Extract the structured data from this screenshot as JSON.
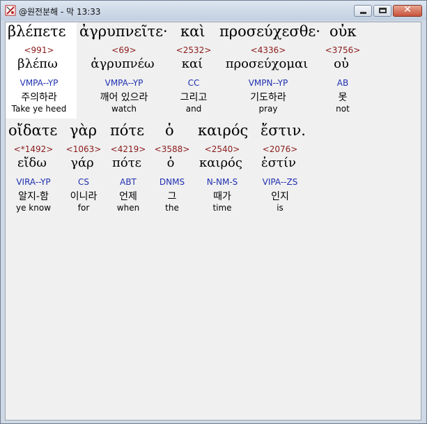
{
  "window": {
    "title": "@원전분해 - 막 13:33",
    "icon": "bible-app-icon"
  },
  "verse_line_1": [
    {
      "greek": "βλέπετε",
      "strong": "<991>",
      "lemma": "βλέπω",
      "parsing": "VMPA--YP",
      "korean": "주의하라",
      "english": "Take ye heed"
    },
    {
      "greek": "ἀγρυπνεῖτε·",
      "strong": "<69>",
      "lemma": "ἀγρυπνέω",
      "parsing": "VMPA--YP",
      "korean": "깨어 있으라",
      "english": "watch"
    },
    {
      "greek": "καὶ",
      "strong": "<2532>",
      "lemma": "καί",
      "parsing": "CC",
      "korean": "그리고",
      "english": "and"
    },
    {
      "greek": "προσεύχεσθε·",
      "strong": "<4336>",
      "lemma": "προσεύχομαι",
      "parsing": "VMPN--YP",
      "korean": "기도하라",
      "english": "pray"
    },
    {
      "greek": "οὐκ",
      "strong": "<3756>",
      "lemma": "οὐ",
      "parsing": "AB",
      "korean": "못",
      "english": "not"
    }
  ],
  "verse_line_2": [
    {
      "greek": "οἴδατε",
      "strong": "<*1492>",
      "lemma": "εἴδω",
      "parsing": "VIRA--YP",
      "korean": "알지-함",
      "english": "ye know"
    },
    {
      "greek": "γὰρ",
      "strong": "<1063>",
      "lemma": "γάρ",
      "parsing": "CS",
      "korean": "이니라",
      "english": "for"
    },
    {
      "greek": "πότε",
      "strong": "<4219>",
      "lemma": "πότε",
      "parsing": "ABT",
      "korean": "언제",
      "english": "when"
    },
    {
      "greek": "ὁ",
      "strong": "<3588>",
      "lemma": "ὁ",
      "parsing": "DNMS",
      "korean": "그",
      "english": "the"
    },
    {
      "greek": "καιρός",
      "strong": "<2540>",
      "lemma": "καιρός",
      "parsing": "N-NM-S",
      "korean": "때가",
      "english": "time"
    },
    {
      "greek": "ἔστιν.",
      "strong": "<2076>",
      "lemma": "ἐστίν",
      "parsing": "VIPA--ZS",
      "korean": "인지",
      "english": "is"
    }
  ]
}
